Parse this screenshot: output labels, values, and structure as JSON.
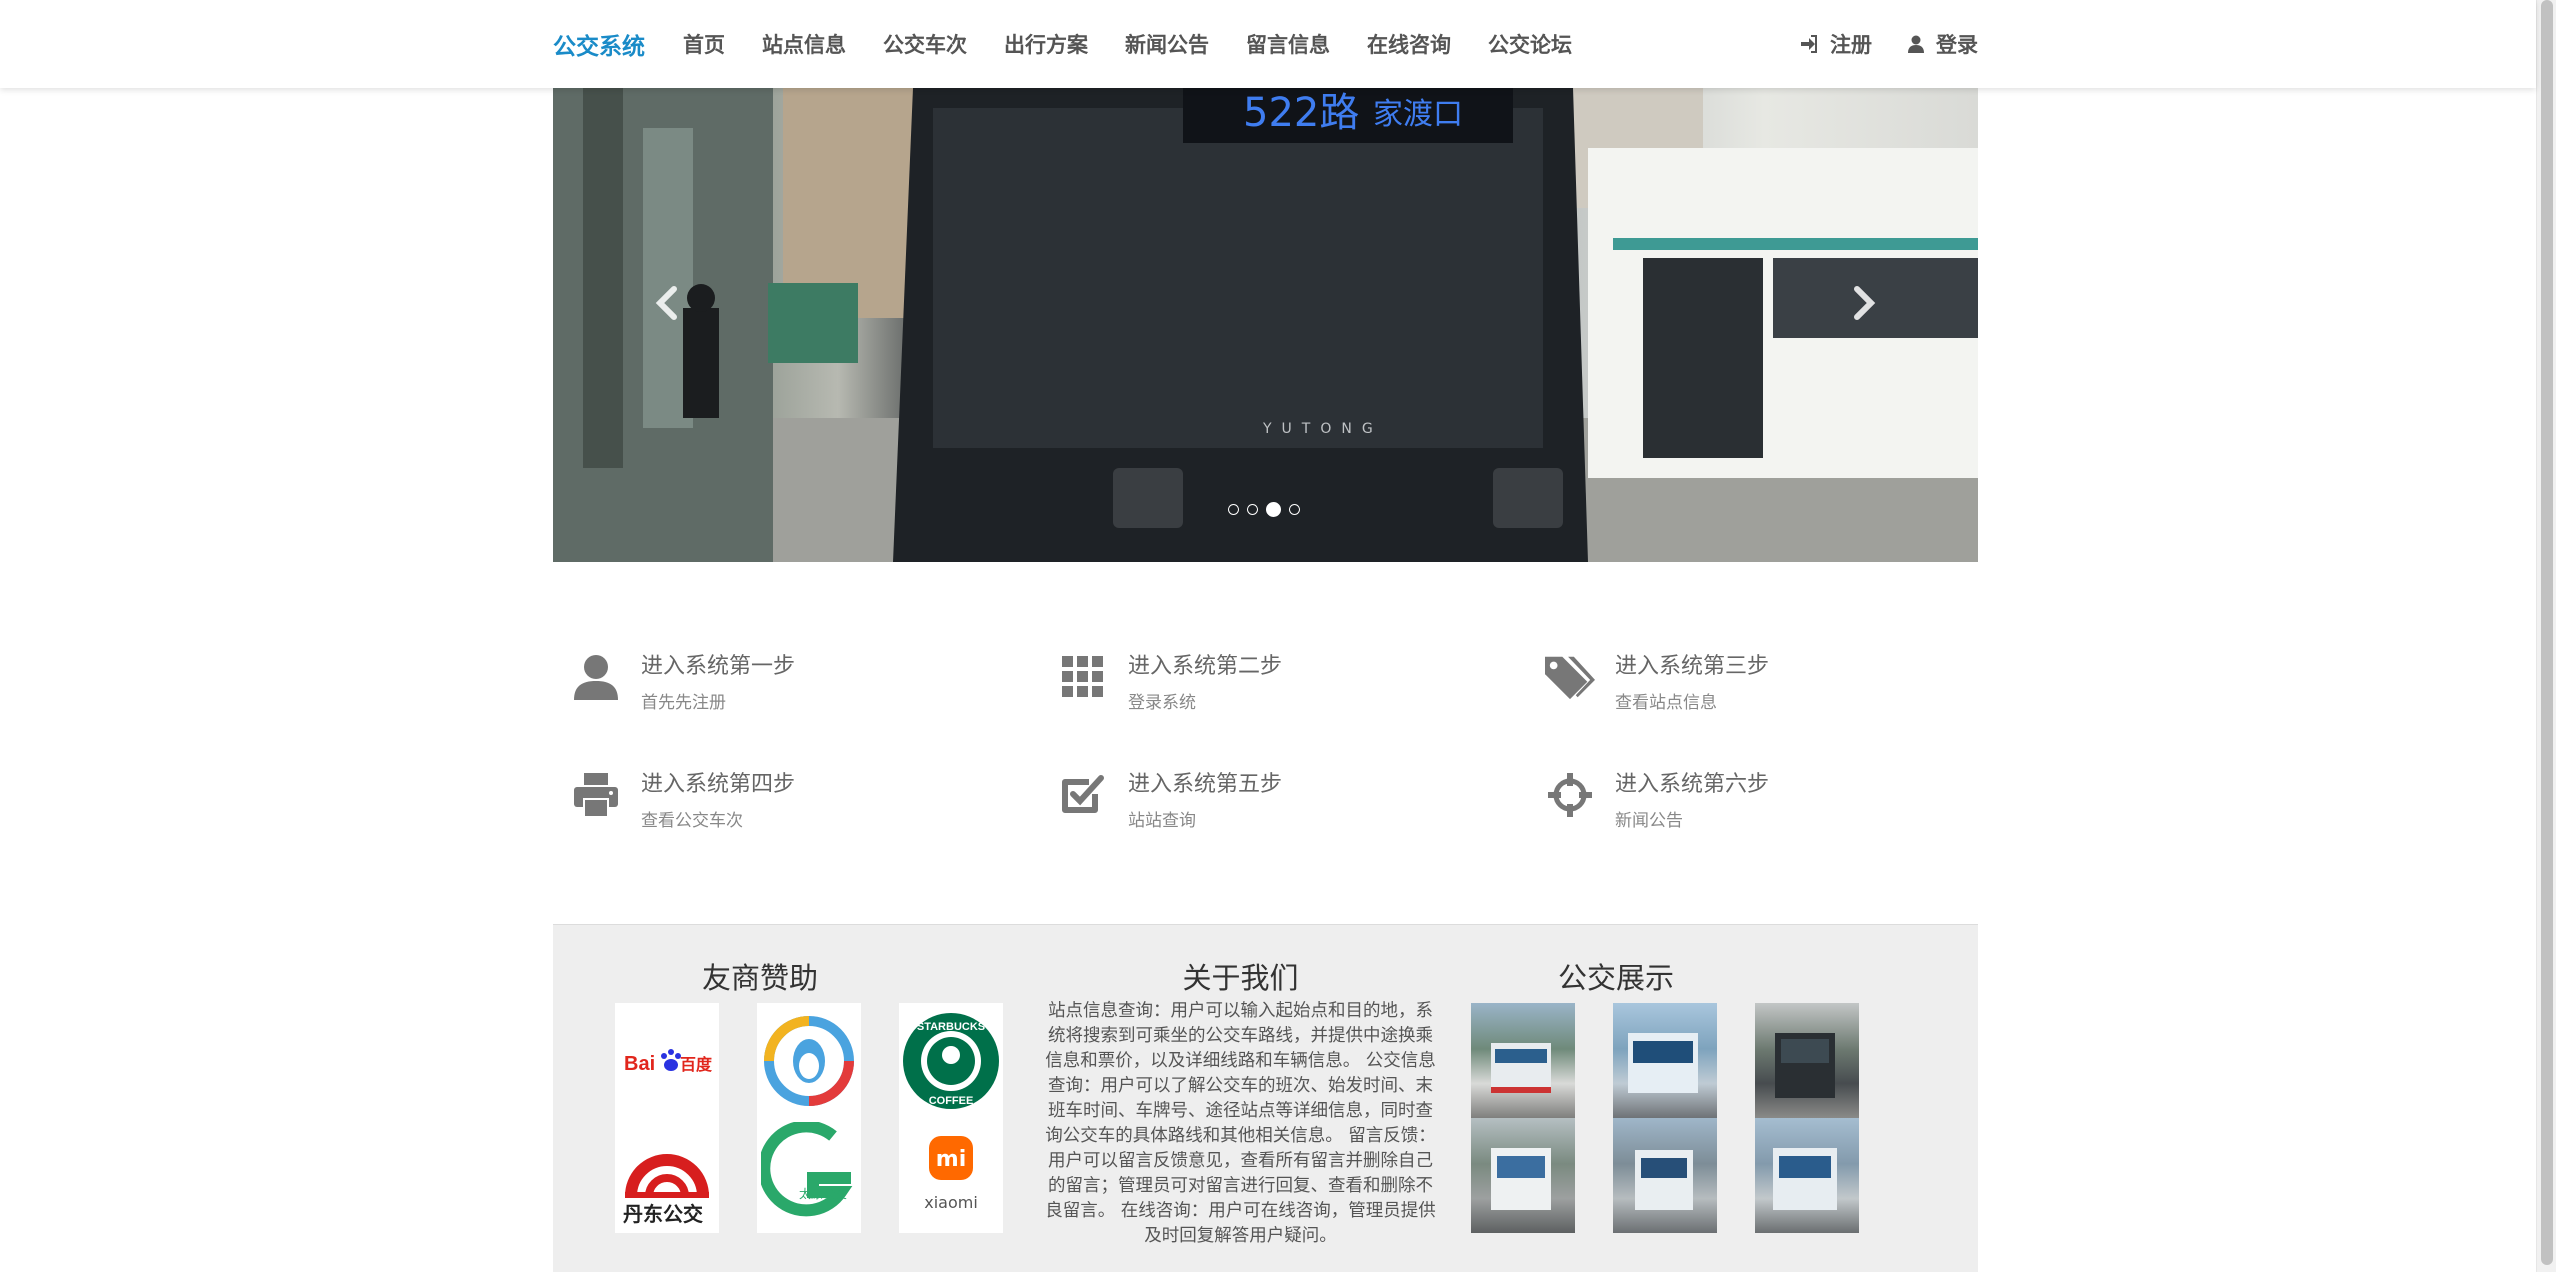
{
  "nav": {
    "brand": "公交系统",
    "items": [
      "首页",
      "站点信息",
      "公交车次",
      "出行方案",
      "新闻公告",
      "留言信息",
      "在线咨询",
      "公交论坛"
    ],
    "register": "注册",
    "login": "登录"
  },
  "carousel": {
    "slide_count": 4,
    "active_index": 2,
    "sign_text": "522路",
    "sign_dest": "家渡口",
    "brand_text": "YUTONG"
  },
  "steps": [
    {
      "title": "进入系统第一步",
      "sub": "首先先注册",
      "icon": "user-icon"
    },
    {
      "title": "进入系统第二步",
      "sub": "登录系统",
      "icon": "grid-icon"
    },
    {
      "title": "进入系统第三步",
      "sub": "查看站点信息",
      "icon": "tags-icon"
    },
    {
      "title": "进入系统第四步",
      "sub": "查看公交车次",
      "icon": "printer-icon"
    },
    {
      "title": "进入系统第五步",
      "sub": "站站查询",
      "icon": "checkbox-icon"
    },
    {
      "title": "进入系统第六步",
      "sub": "新闻公告",
      "icon": "crosshairs-icon"
    }
  ],
  "footer": {
    "sponsors_title": "友商赞助",
    "about_title": "关于我们",
    "showcase_title": "公交展示",
    "about_text": "站点信息查询：用户可以输入起始点和目的地，系统将搜索到可乘坐的公交车路线，并提供中途换乘信息和票价，以及详细线路和车辆信息。 公交信息查询：用户可以了解公交车的班次、始发时间、末班车时间、车牌号、途径站点等详细信息，同时查询公交车的具体路线和其他相关信息。 留言反馈：用户可以留言反馈意见，查看所有留言并删除自己的留言；管理员可对留言进行回复、查看和删除不良留言。 在线咨询：用户可在线咨询，管理员提供及时回复解答用户疑问。",
    "sponsor_logos": [
      {
        "name": "baidu-logo",
        "text": "Bai百度"
      },
      {
        "name": "qq-logo",
        "text": ""
      },
      {
        "name": "starbucks-logo",
        "text": "STARBUCKS COFFEE"
      },
      {
        "name": "dandong-bus-logo",
        "text": "丹东公交"
      },
      {
        "name": "taiyuan-bus-logo",
        "text": "太原公交"
      },
      {
        "name": "xiaomi-logo",
        "text": "xiaomi"
      }
    ]
  },
  "colors": {
    "brand": "#1a8bc8",
    "nav_text": "#555555",
    "footer_bg": "#eeeeee"
  }
}
